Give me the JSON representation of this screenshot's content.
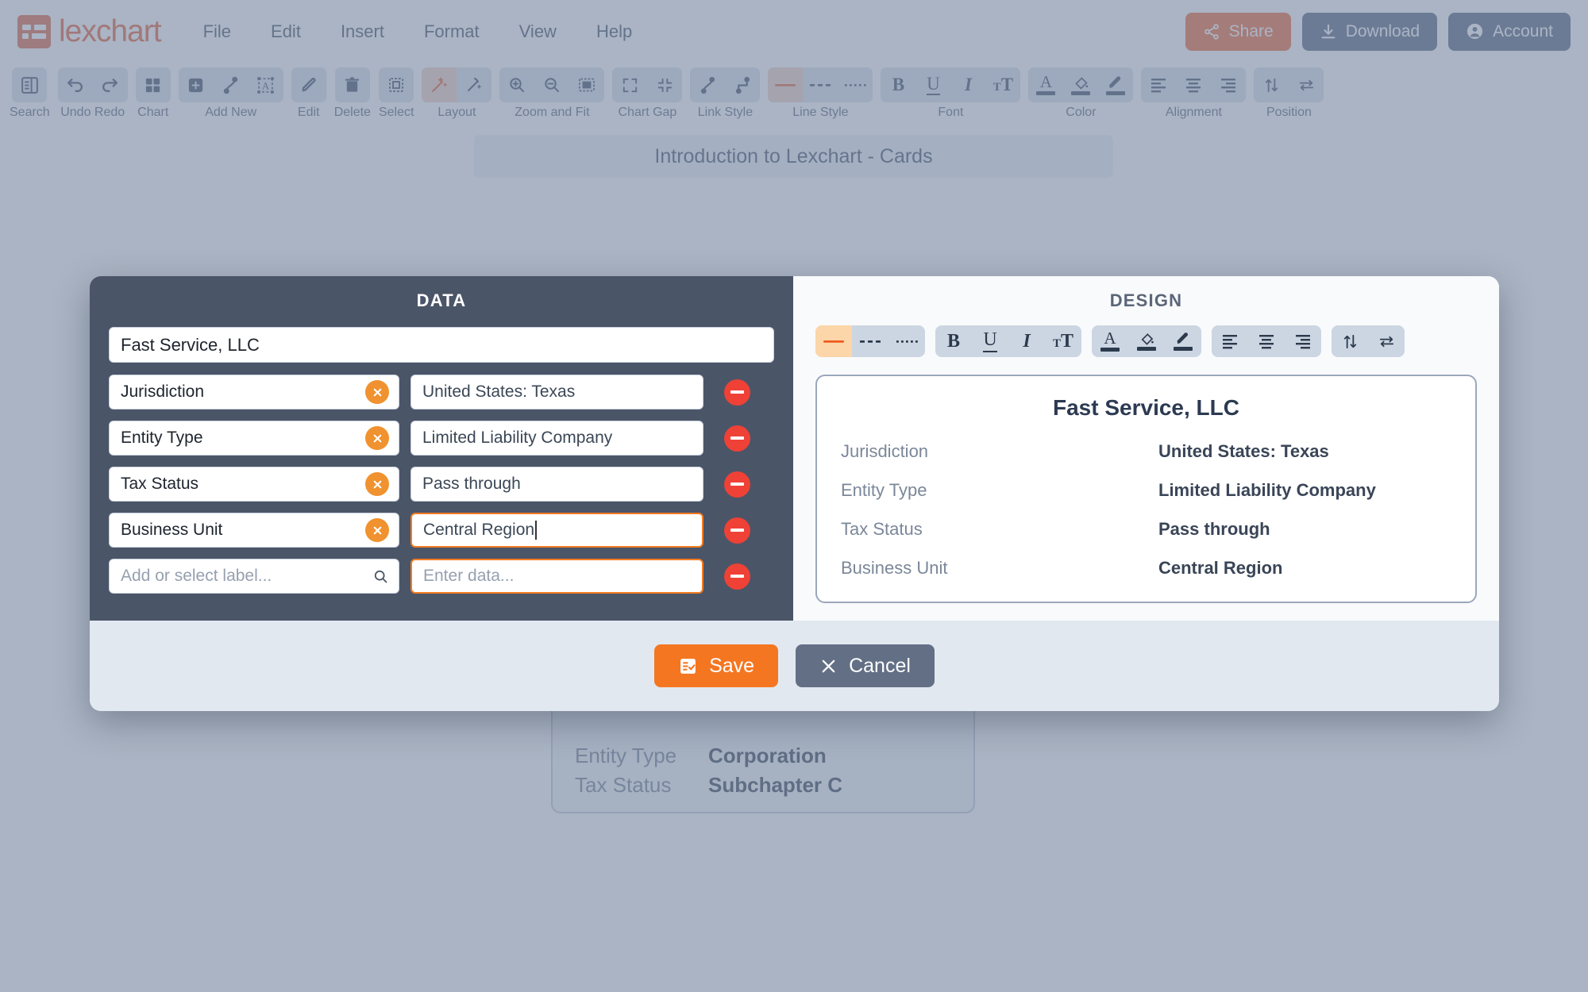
{
  "app": {
    "brand": "lexchart",
    "menu": [
      "File",
      "Edit",
      "Insert",
      "Format",
      "View",
      "Help"
    ],
    "actions": {
      "share": "Share",
      "download": "Download",
      "account": "Account"
    }
  },
  "toolbar": {
    "groups": [
      {
        "label": "Search",
        "icons": [
          "search-panel-icon"
        ]
      },
      {
        "label": "Undo Redo",
        "icons": [
          "undo-icon",
          "redo-icon"
        ]
      },
      {
        "label": "Chart",
        "icons": [
          "grid-chart-icon"
        ]
      },
      {
        "label": "Add New",
        "icons": [
          "add-box-icon",
          "add-link-icon",
          "add-text-icon"
        ]
      },
      {
        "label": "Edit",
        "icons": [
          "pencil-icon"
        ]
      },
      {
        "label": "Delete",
        "icons": [
          "trash-icon"
        ]
      },
      {
        "label": "Select",
        "icons": [
          "marquee-select-icon"
        ]
      },
      {
        "label": "Layout",
        "icons": [
          "magic-wand-icon",
          "magic-pen-icon"
        ]
      },
      {
        "label": "Zoom and Fit",
        "icons": [
          "zoom-in-icon",
          "zoom-out-icon",
          "fit-screen-icon"
        ]
      },
      {
        "label": "Chart Gap",
        "icons": [
          "expand-gap-icon",
          "collapse-gap-icon"
        ]
      },
      {
        "label": "Link Style",
        "icons": [
          "curved-link-icon",
          "orthogonal-link-icon"
        ]
      },
      {
        "label": "Line Style",
        "icons": [
          "solid-line-icon",
          "dashed-line-icon",
          "dotted-line-icon"
        ]
      },
      {
        "label": "Font",
        "icons": [
          "bold-icon",
          "underline-icon",
          "italic-icon",
          "font-size-icon"
        ]
      },
      {
        "label": "Color",
        "icons": [
          "text-color-icon",
          "fill-color-icon",
          "line-color-icon"
        ]
      },
      {
        "label": "Alignment",
        "icons": [
          "align-left-icon",
          "align-center-icon",
          "align-right-icon"
        ]
      },
      {
        "label": "Position",
        "icons": [
          "swap-vertical-icon",
          "swap-horizontal-icon"
        ]
      }
    ]
  },
  "canvas": {
    "chart_title": "Introduction to Lexchart - Cards",
    "background_card": {
      "rows": [
        {
          "key": "Entity Type",
          "value": "Corporation"
        },
        {
          "key": "Tax Status",
          "value": "Subchapter C"
        }
      ]
    }
  },
  "modal": {
    "data_panel": {
      "title": "DATA",
      "name_value": "Fast Service, LLC",
      "rows": [
        {
          "label": "Jurisdiction",
          "value": "United States: Texas",
          "label_placeholder": false,
          "value_active": false
        },
        {
          "label": "Entity Type",
          "value": "Limited Liability Company",
          "label_placeholder": false,
          "value_active": false
        },
        {
          "label": "Tax Status",
          "value": "Pass through",
          "label_placeholder": false,
          "value_active": false
        },
        {
          "label": "Business Unit",
          "value": "Central Region",
          "label_placeholder": false,
          "value_active": true
        }
      ],
      "new_row": {
        "label_placeholder": "Add or select label...",
        "value_placeholder": "Enter data..."
      }
    },
    "design_panel": {
      "title": "DESIGN",
      "toolbar_groups": [
        {
          "name": "line-style",
          "icons": [
            "solid-line-icon",
            "dashed-line-icon",
            "dotted-line-icon"
          ],
          "selected": 0
        },
        {
          "name": "font",
          "icons": [
            "bold-icon",
            "underline-icon",
            "italic-icon",
            "font-size-icon"
          ],
          "selected": -1
        },
        {
          "name": "color",
          "icons": [
            "text-color-icon",
            "fill-color-icon",
            "line-color-icon"
          ],
          "selected": -1
        },
        {
          "name": "alignment",
          "icons": [
            "align-left-icon",
            "align-center-icon",
            "align-right-icon"
          ],
          "selected": -1
        },
        {
          "name": "position",
          "icons": [
            "swap-vertical-icon",
            "swap-horizontal-icon"
          ],
          "selected": -1
        }
      ],
      "preview": {
        "title": "Fast Service, LLC",
        "rows": [
          {
            "key": "Jurisdiction",
            "value": "United States: Texas"
          },
          {
            "key": "Entity Type",
            "value": "Limited Liability Company"
          },
          {
            "key": "Tax Status",
            "value": "Pass through"
          },
          {
            "key": "Business Unit",
            "value": "Central Region"
          }
        ]
      }
    },
    "footer": {
      "save": "Save",
      "cancel": "Cancel"
    }
  },
  "colors": {
    "brand_orange": "#e8633c",
    "accent_orange": "#f57621",
    "data_panel_bg": "#4b5568",
    "remove_red": "#ef4136",
    "clear_orange": "#f0922f"
  }
}
